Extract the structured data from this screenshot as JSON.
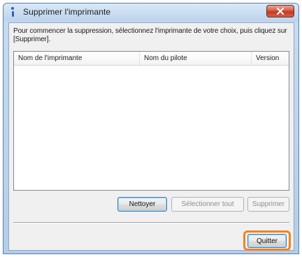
{
  "window": {
    "title": "Supprimer l'imprimante",
    "close_icon": "close-icon"
  },
  "instruction": "Pour commencer la suppression, sélectionnez l'imprimante de votre choix, puis cliquez sur [Supprimer].",
  "printer_list": {
    "columns": [
      "Nom de l'imprimante",
      "Nom du pilote",
      "Version"
    ],
    "rows": []
  },
  "buttons": {
    "nettoyer": "Nettoyer",
    "select_all": "Sélectionner tout",
    "supprimer": "Supprimer",
    "quitter": "Quitter"
  },
  "colors": {
    "highlight": "#f5821f",
    "close_button": "#c2391f",
    "title_bar": "#bcd3ec"
  }
}
